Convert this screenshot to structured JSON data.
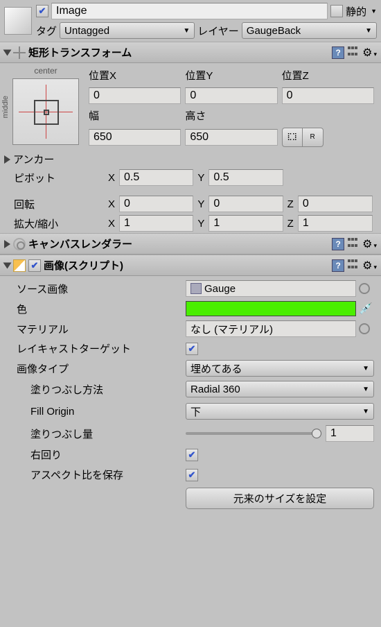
{
  "header": {
    "name": "Image",
    "static": "静的"
  },
  "tag": {
    "label": "タグ",
    "value": "Untagged"
  },
  "layer": {
    "label": "レイヤー",
    "value": "GaugeBack"
  },
  "rectTransform": {
    "title": "矩形トランスフォーム",
    "anchorPresetTop": "center",
    "anchorPresetSide": "middle",
    "posX": {
      "label": "位置X",
      "value": "0"
    },
    "posY": {
      "label": "位置Y",
      "value": "0"
    },
    "posZ": {
      "label": "位置Z",
      "value": "0"
    },
    "width": {
      "label": "幅",
      "value": "650"
    },
    "height": {
      "label": "高さ",
      "value": "650"
    },
    "anchors": "アンカー",
    "pivot": {
      "label": "ピボット",
      "x": "0.5",
      "y": "0.5"
    },
    "rotation": {
      "label": "回転",
      "x": "0",
      "y": "0",
      "z": "0"
    },
    "scale": {
      "label": "拡大/縮小",
      "x": "1",
      "y": "1",
      "z": "1"
    },
    "X": "X",
    "Y": "Y",
    "Z": "Z"
  },
  "canvasRenderer": {
    "title": "キャンバスレンダラー"
  },
  "image": {
    "title": "画像(スクリプト)",
    "sourceImage": {
      "label": "ソース画像",
      "value": "Gauge"
    },
    "color": {
      "label": "色",
      "value": "#4aee00"
    },
    "material": {
      "label": "マテリアル",
      "value": "なし (マテリアル)"
    },
    "raycastTarget": {
      "label": "レイキャストターゲット"
    },
    "imageType": {
      "label": "画像タイプ",
      "value": "埋めてある"
    },
    "fillMethod": {
      "label": "塗りつぶし方法",
      "value": "Radial 360"
    },
    "fillOrigin": {
      "label": "Fill Origin",
      "value": "下"
    },
    "fillAmount": {
      "label": "塗りつぶし量",
      "value": "1"
    },
    "clockwise": {
      "label": "右回り"
    },
    "preserveAspect": {
      "label": "アスペクト比を保存"
    },
    "setNativeSize": "元来のサイズを設定"
  }
}
